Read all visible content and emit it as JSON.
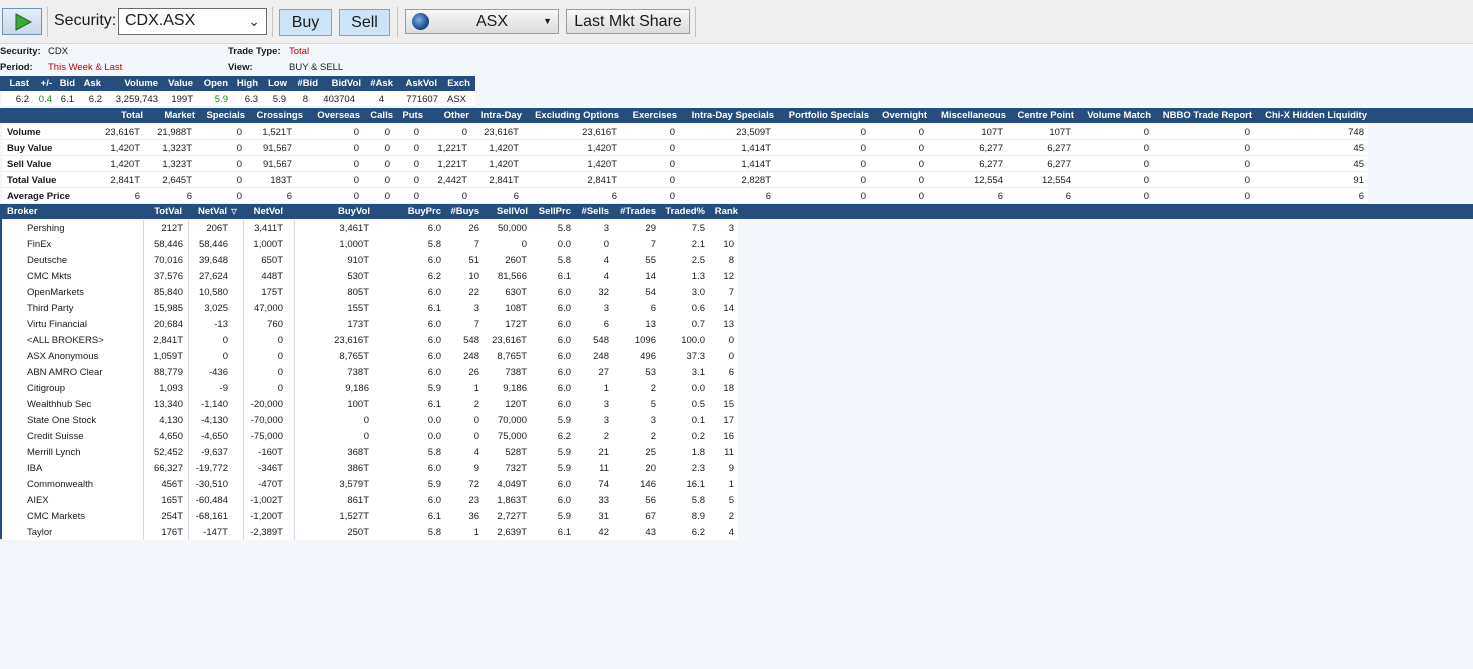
{
  "toolbar": {
    "security_label": "Security:",
    "security_value": "CDX.ASX",
    "buy_label": "Buy",
    "sell_label": "Sell",
    "exchange_value": "ASX",
    "last_mkt_share_label": "Last Mkt Share"
  },
  "info": {
    "security_key": "Security:",
    "security_val": "CDX",
    "period_key": "Period:",
    "period_val": "This Week & Last",
    "trade_type_key": "Trade Type:",
    "trade_type_val": "Total",
    "view_key": "View:",
    "view_val": "BUY & SELL"
  },
  "quote": {
    "headers": [
      "Last",
      "+/-",
      "Bid",
      "Ask",
      "Volume",
      "Value",
      "Open",
      "High",
      "Low",
      "#Bid",
      "BidVol",
      "#Ask",
      "AskVol",
      "Exch"
    ],
    "values": [
      "6.2",
      "0.4",
      "6.1",
      "6.2",
      "3,259,743",
      "199T",
      "5.9",
      "6.3",
      "5.9",
      "8",
      "403704",
      "4",
      "771607",
      "ASX"
    ]
  },
  "summary": {
    "headers": [
      "Total",
      "Market",
      "Specials",
      "Crossings",
      "Overseas",
      "Calls",
      "Puts",
      "Other",
      "Intra-Day",
      "Excluding Options",
      "Exercises",
      "Intra-Day Specials",
      "Portfolio Specials",
      "Overnight",
      "Miscellaneous",
      "Centre Point",
      "Volume Match",
      "NBBO Trade Report",
      "Chi-X Hidden Liquidity"
    ],
    "rows": [
      {
        "label": "Volume",
        "cells": [
          "23,616T",
          "21,988T",
          "0",
          "1,521T",
          "0",
          "0",
          "0",
          "0",
          "23,616T",
          "23,616T",
          "0",
          "23,509T",
          "0",
          "0",
          "107T",
          "107T",
          "0",
          "0",
          "748"
        ]
      },
      {
        "label": "Buy Value",
        "cells": [
          "1,420T",
          "1,323T",
          "0",
          "91,567",
          "0",
          "0",
          "0",
          "1,221T",
          "1,420T",
          "1,420T",
          "0",
          "1,414T",
          "0",
          "0",
          "6,277",
          "6,277",
          "0",
          "0",
          "45"
        ]
      },
      {
        "label": "Sell Value",
        "cells": [
          "1,420T",
          "1,323T",
          "0",
          "91,567",
          "0",
          "0",
          "0",
          "1,221T",
          "1,420T",
          "1,420T",
          "0",
          "1,414T",
          "0",
          "0",
          "6,277",
          "6,277",
          "0",
          "0",
          "45"
        ]
      },
      {
        "label": "Total Value",
        "cells": [
          "2,841T",
          "2,645T",
          "0",
          "183T",
          "0",
          "0",
          "0",
          "2,442T",
          "2,841T",
          "2,841T",
          "0",
          "2,828T",
          "0",
          "0",
          "12,554",
          "12,554",
          "0",
          "0",
          "91"
        ]
      },
      {
        "label": "Average Price",
        "cells": [
          "6",
          "6",
          "0",
          "6",
          "0",
          "0",
          "0",
          "0",
          "6",
          "6",
          "0",
          "6",
          "0",
          "0",
          "6",
          "6",
          "0",
          "0",
          "6"
        ]
      }
    ]
  },
  "brokers": {
    "headers": [
      "Broker",
      "TotVal",
      "NetVal",
      "NetVol",
      "BuyVol",
      "BuyPrc",
      "#Buys",
      "SellVol",
      "SellPrc",
      "#Sells",
      "#Trades",
      "Traded%",
      "Rank"
    ],
    "rows": [
      [
        "Pershing",
        "212T",
        "206T",
        "3,411T",
        "3,461T",
        "6.0",
        "26",
        "50,000",
        "5.8",
        "3",
        "29",
        "7.5",
        "3"
      ],
      [
        "FinEx",
        "58,446",
        "58,446",
        "1,000T",
        "1,000T",
        "5.8",
        "7",
        "0",
        "0.0",
        "0",
        "7",
        "2.1",
        "10"
      ],
      [
        "Deutsche",
        "70,016",
        "39,648",
        "650T",
        "910T",
        "6.0",
        "51",
        "260T",
        "5.8",
        "4",
        "55",
        "2.5",
        "8"
      ],
      [
        "CMC Mkts",
        "37,576",
        "27,624",
        "448T",
        "530T",
        "6.2",
        "10",
        "81,566",
        "6.1",
        "4",
        "14",
        "1.3",
        "12"
      ],
      [
        "OpenMarkets",
        "85,840",
        "10,580",
        "175T",
        "805T",
        "6.0",
        "22",
        "630T",
        "6.0",
        "32",
        "54",
        "3.0",
        "7"
      ],
      [
        "Third Party",
        "15,985",
        "3,025",
        "47,000",
        "155T",
        "6.1",
        "3",
        "108T",
        "6.0",
        "3",
        "6",
        "0.6",
        "14"
      ],
      [
        "Virtu Financial",
        "20,684",
        "-13",
        "760",
        "173T",
        "6.0",
        "7",
        "172T",
        "6.0",
        "6",
        "13",
        "0.7",
        "13"
      ],
      [
        "<ALL BROKERS>",
        "2,841T",
        "0",
        "0",
        "23,616T",
        "6.0",
        "548",
        "23,616T",
        "6.0",
        "548",
        "1096",
        "100.0",
        "0"
      ],
      [
        "ASX Anonymous",
        "1,059T",
        "0",
        "0",
        "8,765T",
        "6.0",
        "248",
        "8,765T",
        "6.0",
        "248",
        "496",
        "37.3",
        "0"
      ],
      [
        "ABN AMRO Clear",
        "88,779",
        "-436",
        "0",
        "738T",
        "6.0",
        "26",
        "738T",
        "6.0",
        "27",
        "53",
        "3.1",
        "6"
      ],
      [
        "Citigroup",
        "1,093",
        "-9",
        "0",
        "9,186",
        "5.9",
        "1",
        "9,186",
        "6.0",
        "1",
        "2",
        "0.0",
        "18"
      ],
      [
        "Wealthhub Sec",
        "13,340",
        "-1,140",
        "-20,000",
        "100T",
        "6.1",
        "2",
        "120T",
        "6.0",
        "3",
        "5",
        "0.5",
        "15"
      ],
      [
        "State One Stock",
        "4,130",
        "-4,130",
        "-70,000",
        "0",
        "0.0",
        "0",
        "70,000",
        "5.9",
        "3",
        "3",
        "0.1",
        "17"
      ],
      [
        "Credit Suisse",
        "4,650",
        "-4,650",
        "-75,000",
        "0",
        "0.0",
        "0",
        "75,000",
        "6.2",
        "2",
        "2",
        "0.2",
        "16"
      ],
      [
        "Merrill Lynch",
        "52,452",
        "-9,637",
        "-160T",
        "368T",
        "5.8",
        "4",
        "528T",
        "5.9",
        "21",
        "25",
        "1.8",
        "11"
      ],
      [
        "IBA",
        "66,327",
        "-19,772",
        "-346T",
        "386T",
        "6.0",
        "9",
        "732T",
        "5.9",
        "11",
        "20",
        "2.3",
        "9"
      ],
      [
        "Commonwealth",
        "456T",
        "-30,510",
        "-470T",
        "3,579T",
        "5.9",
        "72",
        "4,049T",
        "6.0",
        "74",
        "146",
        "16.1",
        "1"
      ],
      [
        "AIEX",
        "165T",
        "-60,484",
        "-1,002T",
        "861T",
        "6.0",
        "23",
        "1,863T",
        "6.0",
        "33",
        "56",
        "5.8",
        "5"
      ],
      [
        "CMC Markets",
        "254T",
        "-68,161",
        "-1,200T",
        "1,527T",
        "6.1",
        "36",
        "2,727T",
        "5.9",
        "31",
        "67",
        "8.9",
        "2"
      ],
      [
        "Taylor",
        "176T",
        "-147T",
        "-2,389T",
        "250T",
        "5.8",
        "1",
        "2,639T",
        "6.1",
        "42",
        "43",
        "6.2",
        "4"
      ]
    ]
  },
  "colors": {
    "header_bg": "#254e7c",
    "accent_red": "#c00000",
    "positive_green": "#1a8a1a"
  }
}
